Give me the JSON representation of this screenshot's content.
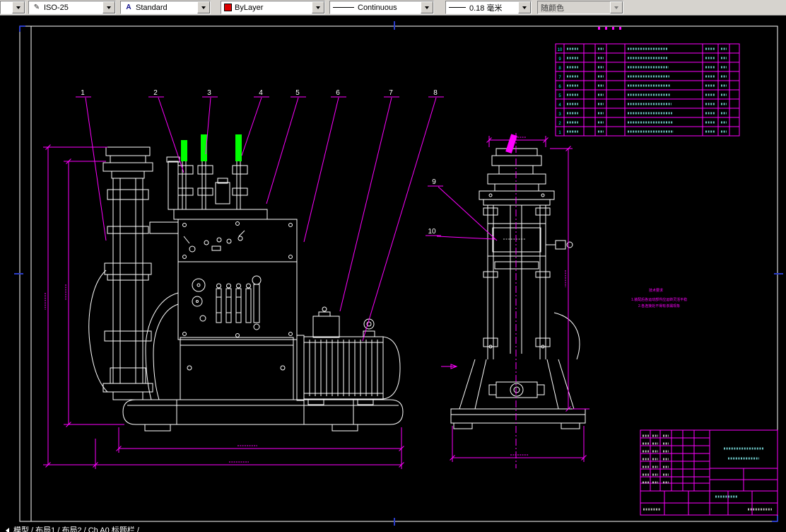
{
  "toolbar": {
    "dim_style": "ISO-25",
    "text_style": "Standard",
    "color": "ByLayer",
    "linetype": "Continuous",
    "lineweight": "0.18 毫米",
    "plot_style": "随颜色"
  },
  "callouts": [
    "1",
    "2",
    "3",
    "4",
    "5",
    "6",
    "7",
    "8",
    "9",
    "10"
  ],
  "annotation": {
    "line1": "技术要求",
    "line2": "1.装配后各运动部件应运转灵活平稳",
    "line3": "2.各连接处不得有渗漏现象"
  },
  "parts_table": {
    "row_numbers": [
      "10",
      "9",
      "8",
      "7",
      "6",
      "5",
      "4",
      "3",
      "2",
      "1"
    ]
  },
  "tab_bar": {
    "text": "模型 / 布局1 / 布局2 / Ch A0 标题栏 /"
  },
  "colors": {
    "dimension_magenta": "#ff00ff",
    "geometry_white": "#ffffff",
    "grip_green": "#00ff00",
    "table_text_cyan": "#00ffff",
    "trim_mark_blue": "#2a3cc8",
    "toolbar_gray": "#d6d3ce"
  }
}
